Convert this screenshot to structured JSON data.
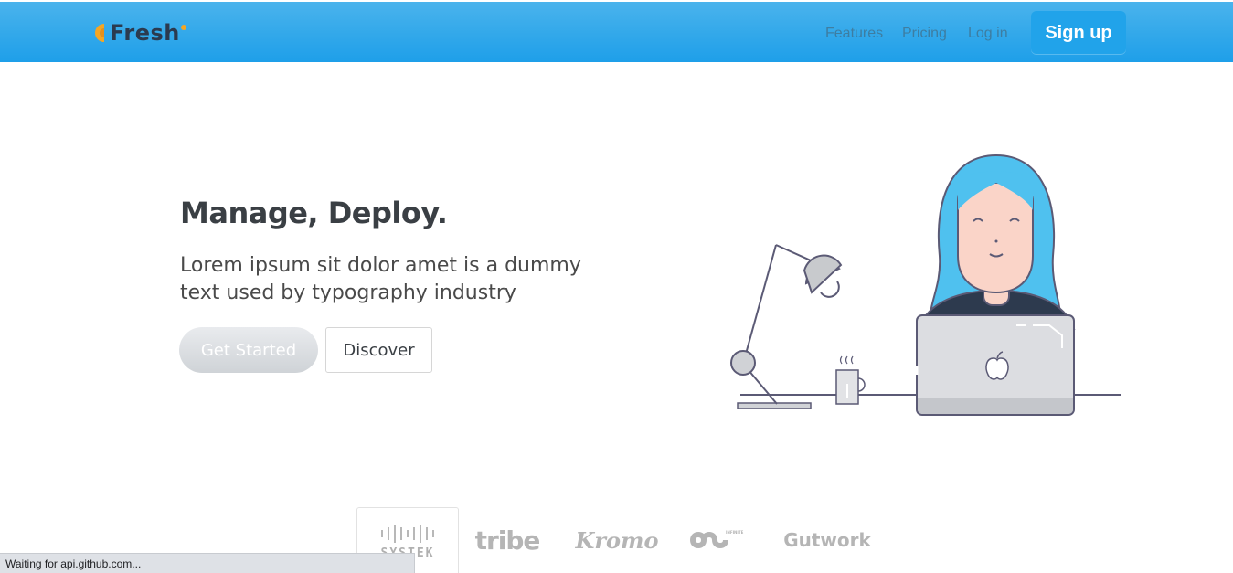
{
  "navbar": {
    "logo_text": "Fresh",
    "links": [
      {
        "label": "Features"
      },
      {
        "label": "Pricing"
      },
      {
        "label": "Log in"
      }
    ],
    "signup_label": "Sign up"
  },
  "hero": {
    "title": "Manage, Deploy.",
    "text": "Lorem ipsum sit dolor amet is a dummy text used by typography industry",
    "primary_button": "Get Started",
    "secondary_button": "Discover"
  },
  "clients": [
    {
      "name": "SYSTEK"
    },
    {
      "name": "tribe"
    },
    {
      "name": "Kromo"
    },
    {
      "name": "INFINITE"
    },
    {
      "name": "Gutwork"
    }
  ],
  "status_bar": {
    "text": "Waiting for api.github.com..."
  },
  "colors": {
    "navbar_top": "#4ab3ec",
    "navbar_bottom": "#1e9fe9",
    "hair": "#4fc1ef",
    "logo_accent": "#f6a623"
  }
}
